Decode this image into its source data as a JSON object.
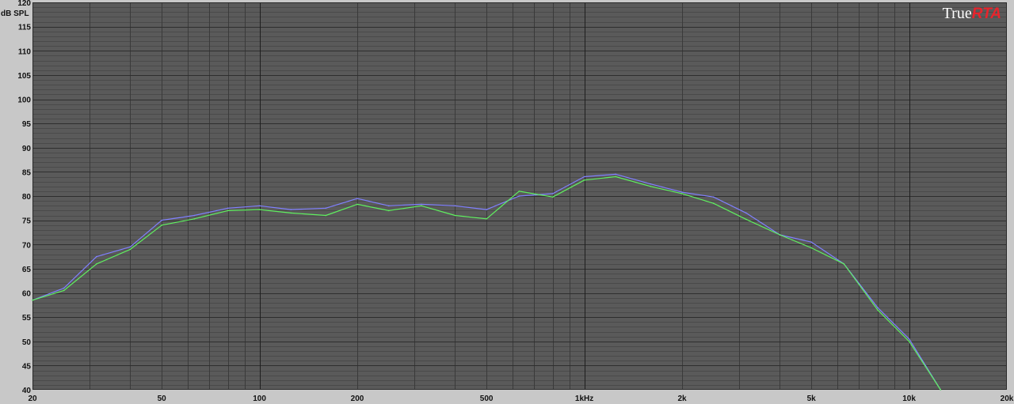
{
  "chart_data": {
    "type": "line",
    "brand": {
      "part1": "True",
      "part2": "RTA"
    },
    "ylabel": "dB SPL",
    "ylim": [
      40,
      120
    ],
    "xlim": [
      20,
      20000
    ],
    "xscale": "log",
    "grid": true,
    "yticks": [
      {
        "value": 120,
        "label": "120"
      },
      {
        "value": 115,
        "label": "115"
      },
      {
        "value": 110,
        "label": "110"
      },
      {
        "value": 105,
        "label": "105"
      },
      {
        "value": 100,
        "label": "100"
      },
      {
        "value": 95,
        "label": "95"
      },
      {
        "value": 90,
        "label": "90"
      },
      {
        "value": 85,
        "label": "85"
      },
      {
        "value": 80,
        "label": "80"
      },
      {
        "value": 75,
        "label": "75"
      },
      {
        "value": 70,
        "label": "70"
      },
      {
        "value": 65,
        "label": "65"
      },
      {
        "value": 60,
        "label": "60"
      },
      {
        "value": 55,
        "label": "55"
      },
      {
        "value": 50,
        "label": "50"
      },
      {
        "value": 45,
        "label": "45"
      },
      {
        "value": 40,
        "label": "40"
      }
    ],
    "xticks": [
      {
        "value": 20,
        "label": "20"
      },
      {
        "value": 50,
        "label": "50"
      },
      {
        "value": 100,
        "label": "100"
      },
      {
        "value": 200,
        "label": "200"
      },
      {
        "value": 500,
        "label": "500"
      },
      {
        "value": 1000,
        "label": "1kHz"
      },
      {
        "value": 2000,
        "label": "2k"
      },
      {
        "value": 5000,
        "label": "5k"
      },
      {
        "value": 10000,
        "label": "10k"
      },
      {
        "value": 20000,
        "label": "20k"
      }
    ],
    "series": [
      {
        "color": "#8080ff",
        "x": [
          20,
          25,
          31.5,
          40,
          50,
          63,
          80,
          100,
          125,
          160,
          200,
          250,
          315,
          400,
          500,
          630,
          800,
          1000,
          1250,
          1600,
          2000,
          2500,
          3150,
          4000,
          5000,
          6300,
          8000,
          10000,
          12500
        ],
        "y": [
          58.5,
          61,
          67.5,
          69.5,
          75,
          76,
          77.5,
          78,
          77.2,
          77.5,
          79.5,
          78,
          78.3,
          78,
          77.2,
          80,
          80.5,
          84,
          84.5,
          82.5,
          80.8,
          79.8,
          76.5,
          72,
          70.5,
          66,
          57,
          50.5,
          40
        ]
      },
      {
        "color": "#60f060",
        "x": [
          20,
          25,
          31.5,
          40,
          50,
          63,
          80,
          100,
          125,
          160,
          200,
          250,
          315,
          400,
          500,
          630,
          800,
          1000,
          1250,
          1600,
          2000,
          2500,
          3150,
          4000,
          5000,
          6300,
          8000,
          10000,
          12500
        ],
        "y": [
          58.5,
          60.5,
          66,
          69,
          74,
          75.3,
          77,
          77.2,
          76.5,
          76,
          78.3,
          77,
          78,
          76,
          75.3,
          81,
          79.8,
          83.3,
          84,
          82,
          80.5,
          78.5,
          75.2,
          72,
          69.3,
          66,
          56.5,
          50,
          40
        ]
      }
    ]
  }
}
